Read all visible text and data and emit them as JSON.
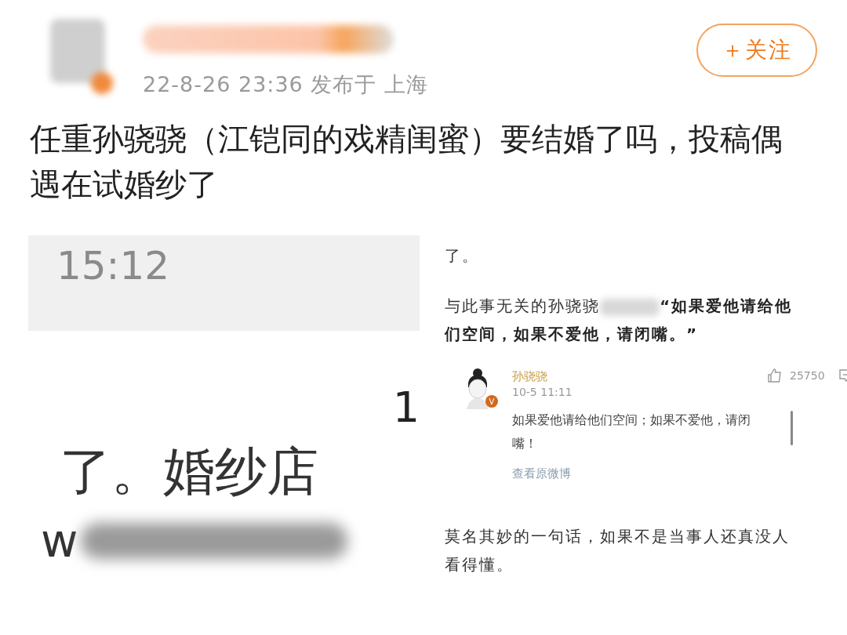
{
  "post": {
    "timestamp": "22-8-26 23:36",
    "location": "发布于 上海",
    "follow_button": "＋关注",
    "text": "任重孙骁骁（江铠同的戏精闺蜜）要结婚了吗，投稿偶遇在试婚纱了"
  },
  "left_image": {
    "clock": "15:12",
    "digit": "1",
    "fragment": "了。婚纱店",
    "letter": "w"
  },
  "right_image": {
    "top_text": "了。",
    "quote_intro": "与此事无关的孙骁骁",
    "quote": "“如果爱他请给他们空间，如果不爱他，请闭嘴。”",
    "card": {
      "name": "孙骁骁",
      "badge": "V",
      "time": "10-5 11:11",
      "likes": "25750",
      "text": "如果爱他请给他们空间；如果不爱他，请闭嘴！",
      "link": "查看原微博"
    },
    "closing": "莫名其妙的一句话，如果不是当事人还真没人看得懂。"
  }
}
